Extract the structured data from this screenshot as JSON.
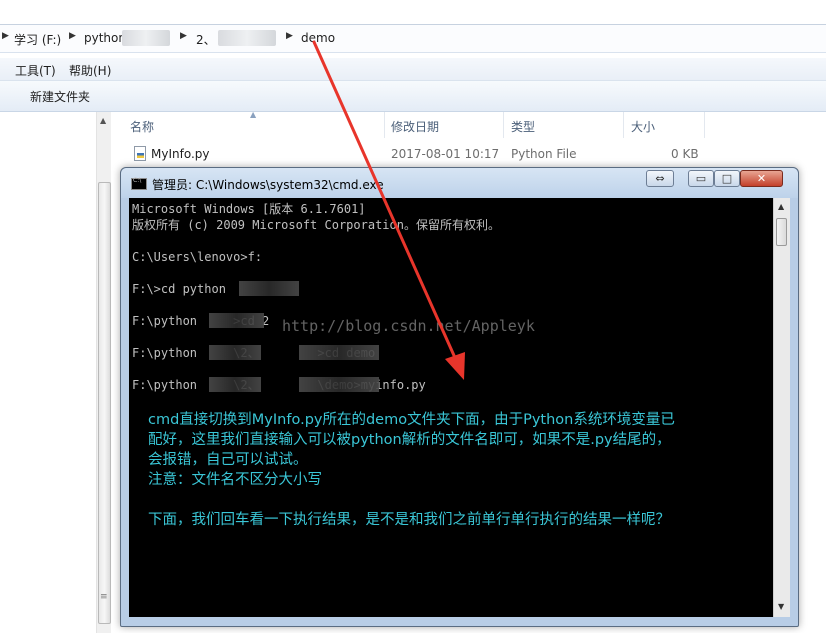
{
  "explorer": {
    "breadcrumbs": [
      "学习 (F:)",
      "python",
      "2、",
      "demo"
    ],
    "menu": [
      "工具(T)",
      "帮助(H)"
    ],
    "toolbar": {
      "new_folder": "新建文件夹"
    },
    "columns": [
      "名称",
      "修改日期",
      "类型",
      "大小"
    ],
    "files": [
      {
        "name": "MyInfo.py",
        "modified": "2017-08-01 10:17",
        "type": "Python File",
        "size": "0 KB"
      }
    ]
  },
  "cmd": {
    "title": "管理员: C:\\Windows\\system32\\cmd.exe",
    "buttons": {
      "restore": "⇔",
      "minimize": "▭",
      "maximize": "□",
      "close": "✕"
    },
    "lines": [
      "Microsoft Windows [版本 6.1.7601]",
      "版权所有 (c) 2009 Microsoft Corporation。保留所有权利。",
      "",
      "C:\\Users\\lenovo>f:",
      "",
      "F:\\>cd python",
      "",
      "F:\\python     >cd 2",
      "",
      "F:\\python     \\2、        >cd demo",
      "",
      "F:\\python     \\2、        \\demo>myinfo.py"
    ],
    "notes": [
      "cmd直接切换到MyInfo.py所在的demo文件夹下面，由于Python系统环境变量已",
      "配好，这里我们直接输入可以被python解析的文件名即可，如果不是.py结尾的，",
      "会报错，自己可以试试。",
      "注意：文件名不区分大小写",
      "",
      "下面，我们回车看一下执行结果，是不是和我们之前单行单行执行的结果一样呢？"
    ]
  },
  "watermark": "http://blog.csdn.net/Appleyk",
  "colors": {
    "note": "#3ac6d6",
    "arrow": "#e8352b",
    "console_bg": "#000000",
    "console_fg": "#c0c0c0"
  }
}
